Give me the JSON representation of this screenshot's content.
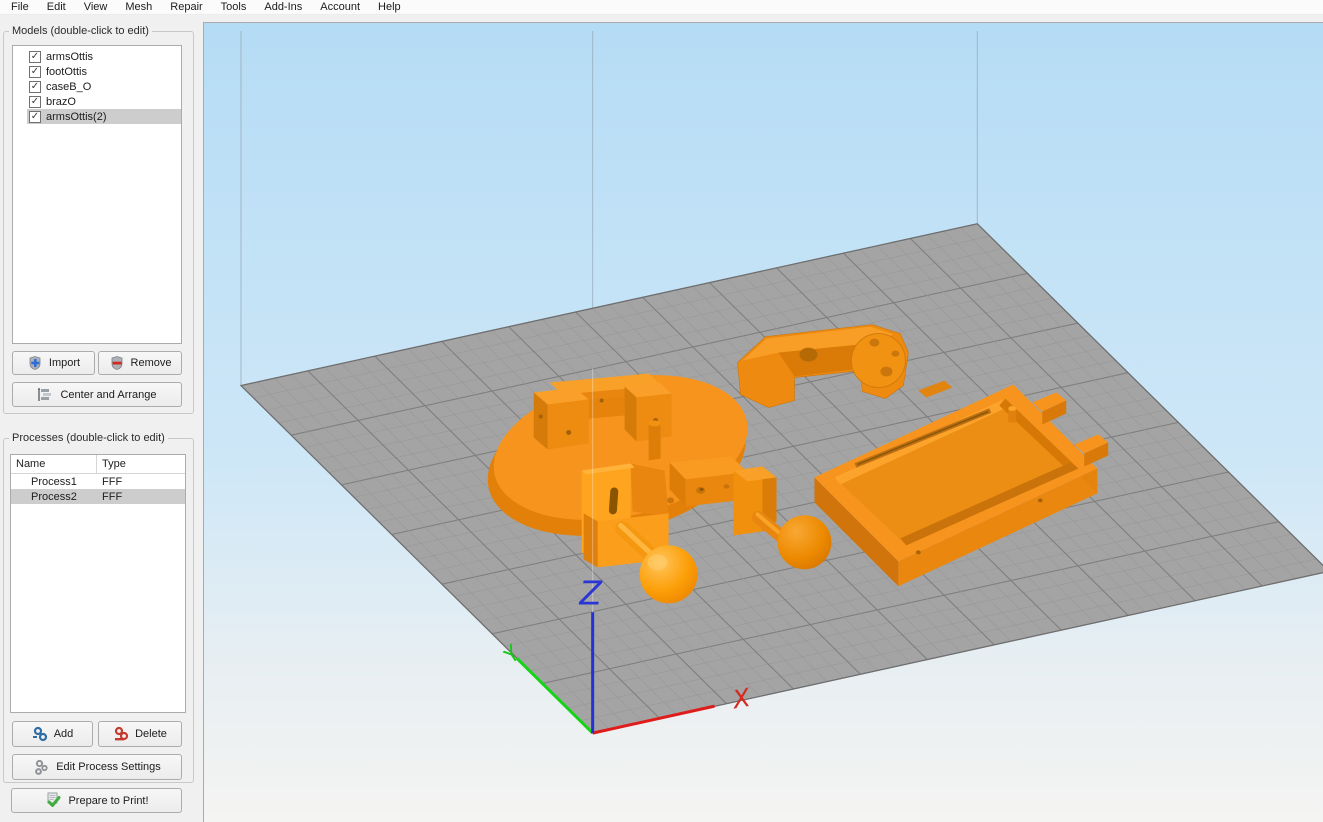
{
  "menu": {
    "items": [
      "File",
      "Edit",
      "View",
      "Mesh",
      "Repair",
      "Tools",
      "Add-Ins",
      "Account",
      "Help"
    ]
  },
  "models_panel": {
    "title": "Models (double-click to edit)",
    "checkbox_glyph": "✓",
    "items": [
      {
        "label": "armsOttis",
        "checked": true,
        "selected": false
      },
      {
        "label": "footOttis",
        "checked": true,
        "selected": false
      },
      {
        "label": "caseB_O",
        "checked": true,
        "selected": false
      },
      {
        "label": "brazO",
        "checked": true,
        "selected": false
      },
      {
        "label": "armsOttis(2)",
        "checked": true,
        "selected": true
      }
    ],
    "import_label": "Import",
    "remove_label": "Remove",
    "center_arrange_label": "Center and Arrange"
  },
  "processes_panel": {
    "title": "Processes (double-click to edit)",
    "columns": [
      "Name",
      "Type"
    ],
    "rows": [
      {
        "name": "Process1",
        "type": "FFF",
        "selected": false
      },
      {
        "name": "Process2",
        "type": "FFF",
        "selected": true
      }
    ],
    "add_label": "Add",
    "delete_label": "Delete",
    "edit_label": "Edit Process Settings"
  },
  "prepare_label": "Prepare to Print!",
  "viewport": {
    "axis_labels": {
      "x": "X",
      "y": "Y",
      "z": "Z"
    }
  },
  "colors": {
    "model_orange": "#F7941E",
    "platform_gray": "#A4A4A4",
    "axis_x": "#D42A20",
    "axis_y": "#14C814",
    "axis_z": "#2B35D6",
    "selection_gray": "#CDCDCD",
    "sky_top": "#B5DCF5",
    "sky_bottom": "#F4F4F2"
  }
}
